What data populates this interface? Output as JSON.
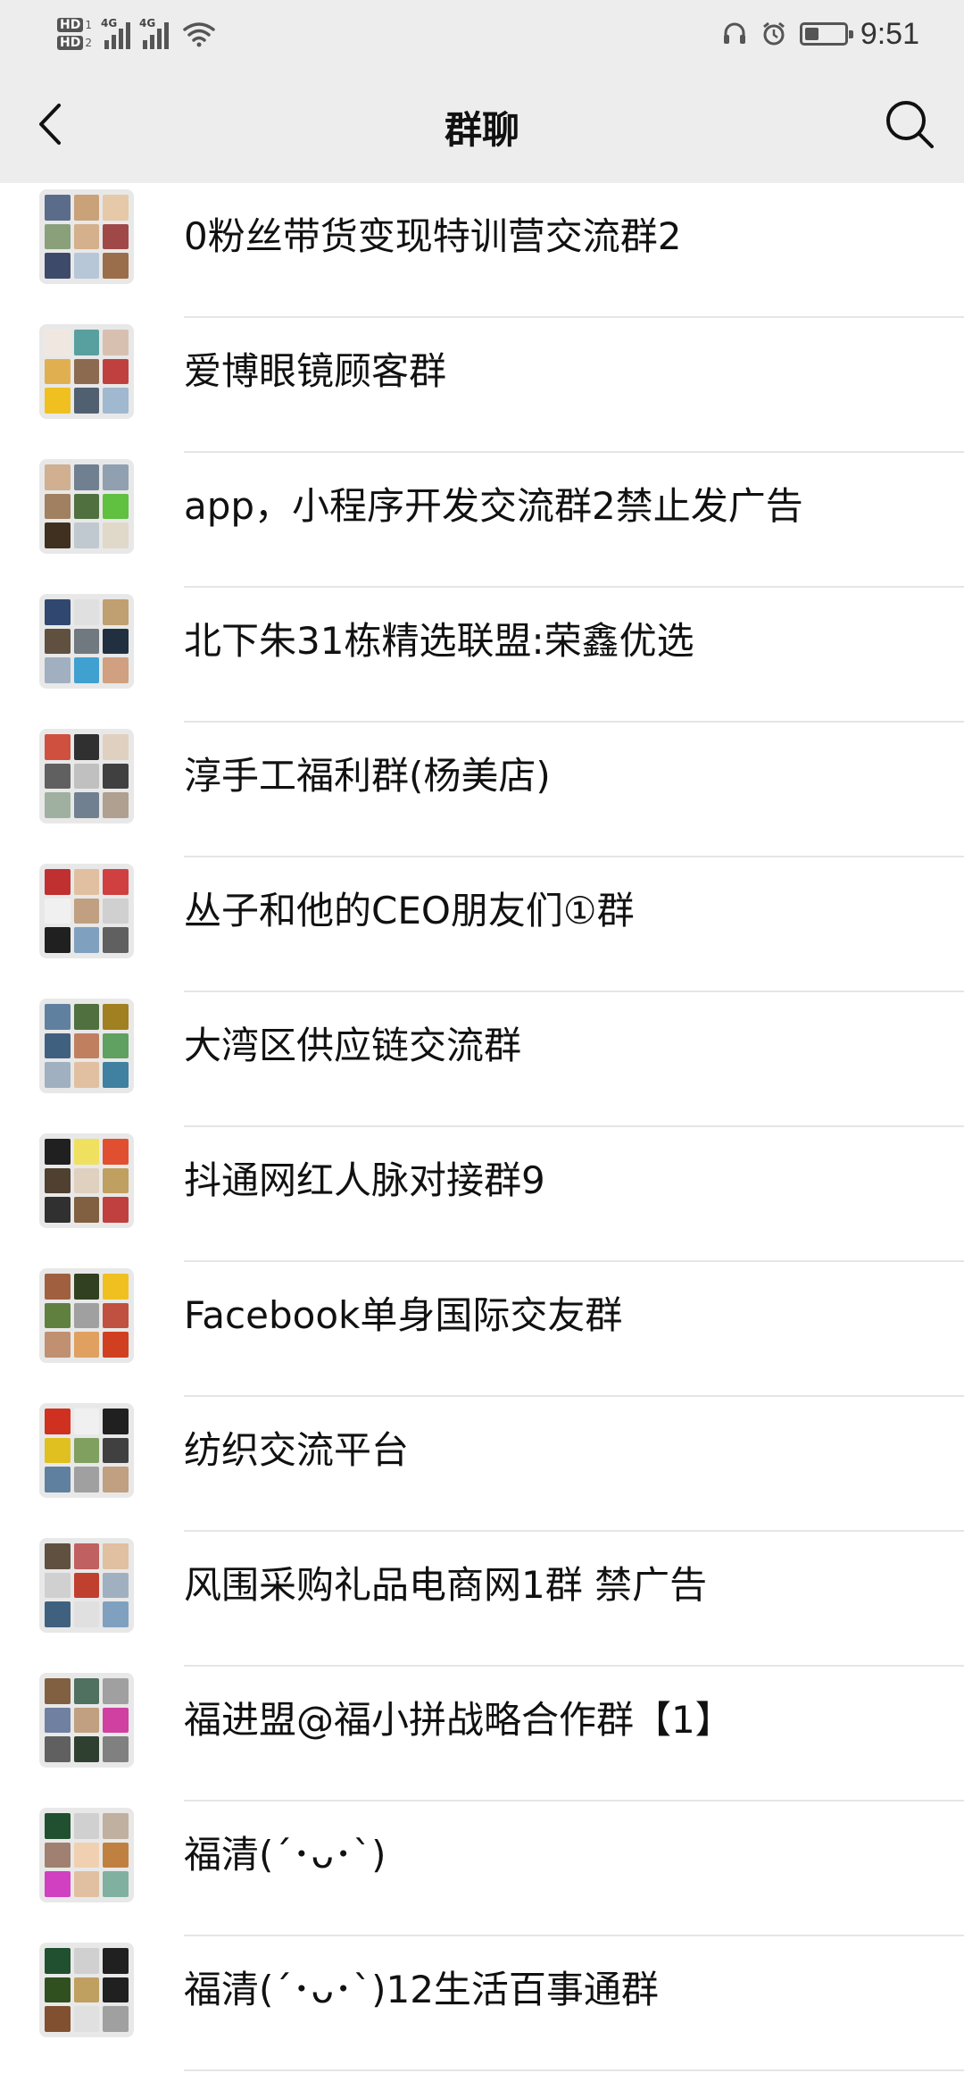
{
  "status_bar": {
    "hd1": "HD",
    "hd1_sub": "1",
    "hd2": "HD",
    "hd2_sub": "2",
    "net1": "4G",
    "net2": "4G",
    "battery_level": 0.35,
    "time": "9:51"
  },
  "header": {
    "title": "群聊",
    "back_icon": "back-chevron-icon",
    "search_icon": "search-icon"
  },
  "groups": [
    {
      "name": "0粉丝带货变现特训营交流群2"
    },
    {
      "name": "爱博眼镜顾客群"
    },
    {
      "name": "app，小程序开发交流群2禁止发广告"
    },
    {
      "name": "北下朱31栋精选联盟:荣鑫优选"
    },
    {
      "name": "淳手工福利群(杨美店)"
    },
    {
      "name": "丛子和他的CEO朋友们①群"
    },
    {
      "name": "大湾区供应链交流群"
    },
    {
      "name": "抖通网红人脉对接群9"
    },
    {
      "name": "Facebook单身国际交友群"
    },
    {
      "name": "纺织交流平台"
    },
    {
      "name": "风围采购礼品电商网1群 禁广告"
    },
    {
      "name": "福进盟@福小拼战略合作群【1】"
    },
    {
      "name": "福清(´･ᴗ･`)"
    },
    {
      "name": "福清(´･ᴗ･`)12生活百事通群"
    }
  ]
}
